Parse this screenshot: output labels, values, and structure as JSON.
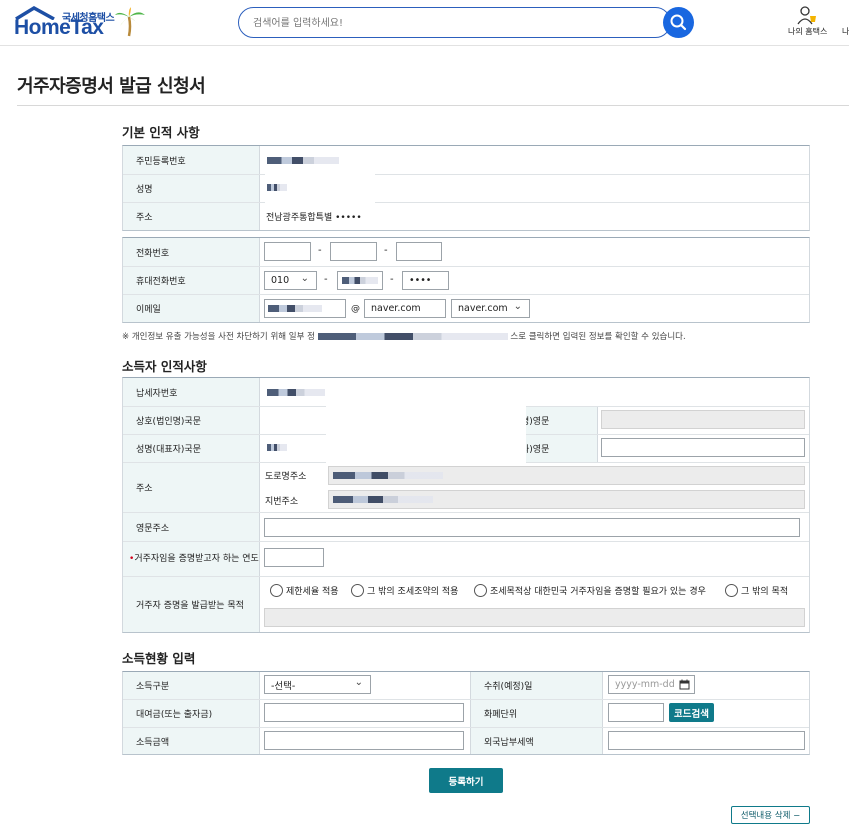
{
  "header": {
    "logo_sub": "국세청홈택스",
    "logo_main": "HomeTax",
    "search_placeholder": "검색어를 입력하세요!",
    "my_hometax": "나의 홈택스",
    "extra_link": "나"
  },
  "page_title": "거주자증명서 발급 신청서",
  "sections": {
    "basic": "기본 인적 사항",
    "earner": "소득자 인적사항",
    "income": "소득현황 입력"
  },
  "basic": {
    "rrn_label": "주민등록번호",
    "name_label": "성명",
    "address_label": "주소",
    "address_value": "전남광주통합특별 •••••",
    "phone_label": "전화번호",
    "mobile_label": "휴대전화번호",
    "mobile_prefix": "010",
    "mobile_last": "••••",
    "email_label": "이메일",
    "email_at": "@",
    "email_domain": "naver.com",
    "email_domain_select": "naver.com",
    "privacy_note_start": "※ 개인정보 유출 가능성을 사전 차단하기 위해 일부 정",
    "privacy_note_end": "스로 클릭하면 입력된 정보를 확인할 수 있습니다."
  },
  "earner": {
    "tin_label": "납세자번호",
    "company_kr_label": "상호(법인명)국문",
    "company_en_label_tail": "명)영문",
    "rep_kr_label": "성명(대표자)국문",
    "rep_en_label_tail": "자)영문",
    "address_label": "주소",
    "road_address_label": "도로명주소",
    "lot_address_label": "지번주소",
    "english_address_label": "영문주소",
    "year_label_req": "•",
    "year_label": "거주자임을 증명받고자 하는 연도",
    "purpose_label": "거주자 증명을 발급받는 목적",
    "purposes": [
      "제한세율 적용",
      "그 밖의 조세조약의 적용",
      "조세목적상 대한민국 거주자임을 증명할 필요가 있는 경우",
      "그 밖의 목적"
    ]
  },
  "income": {
    "type_label": "소득구분",
    "type_value": "-선택-",
    "date_label": "수취(예정)일",
    "date_placeholder": "yyyy-mm-dd",
    "loan_label": "대여금(또는 출자금)",
    "currency_label": "화폐단위",
    "code_search_button": "코드검색",
    "amount_label": "소득금액",
    "foreign_tax_label": "외국납부세액"
  },
  "buttons": {
    "register": "등록하기",
    "delete_selected": "선택내용 삭제 −"
  }
}
